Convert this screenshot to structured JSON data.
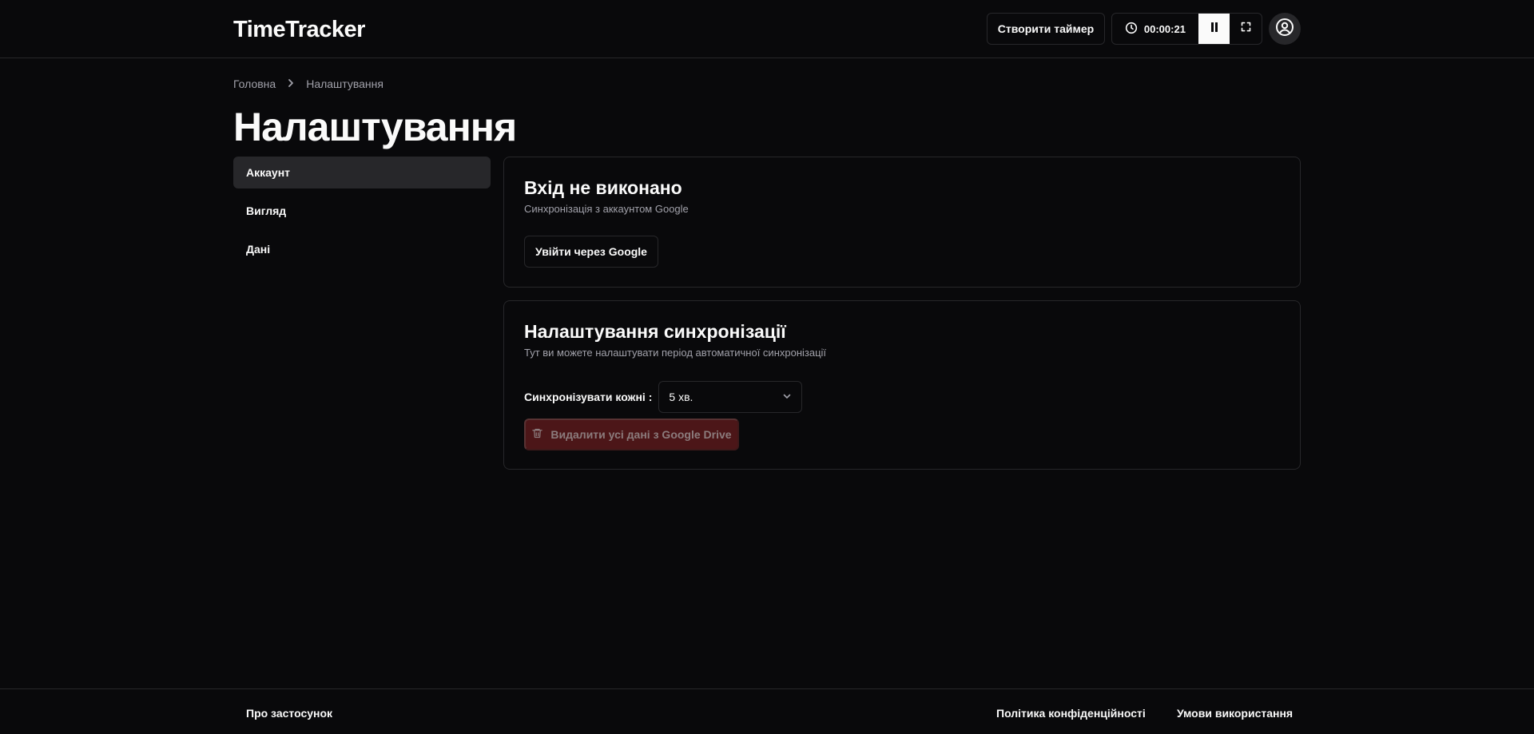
{
  "header": {
    "logo": "TimeTracker",
    "create_timer_label": "Створити таймер",
    "timer_value": "00:00:21"
  },
  "breadcrumb": {
    "home": "Головна",
    "current": "Налаштування"
  },
  "page": {
    "title": "Налаштування"
  },
  "sidebar": {
    "items": [
      {
        "label": "Аккаунт",
        "active": true
      },
      {
        "label": "Вигляд",
        "active": false
      },
      {
        "label": "Дані",
        "active": false
      }
    ]
  },
  "account_card": {
    "title": "Вхід не виконано",
    "description": "Синхронізація з аккаунтом Google",
    "login_button": "Увійти через Google"
  },
  "sync_card": {
    "title": "Налаштування синхронізації",
    "description": "Тут ви можете налаштувати період автоматичної синхронізації",
    "interval_label": "Синхронізувати кожні :",
    "interval_value": "5 хв.",
    "delete_button": "Видалити усі дані з Google Drive"
  },
  "footer": {
    "about": "Про застосунок",
    "privacy": "Політика конфіденційності",
    "terms": "Умови використання"
  },
  "icons": {
    "clock": "clock-icon",
    "pause": "pause-icon",
    "fullscreen": "fullscreen-icon",
    "user": "user-circle-icon",
    "chevron_right": "chevron-right-icon",
    "chevron_down": "chevron-down-icon",
    "trash": "trash-icon"
  },
  "colors": {
    "background": "#09090b",
    "border": "#27272a",
    "muted_text": "#a1a1aa",
    "destructive_bg": "#4c1618"
  }
}
